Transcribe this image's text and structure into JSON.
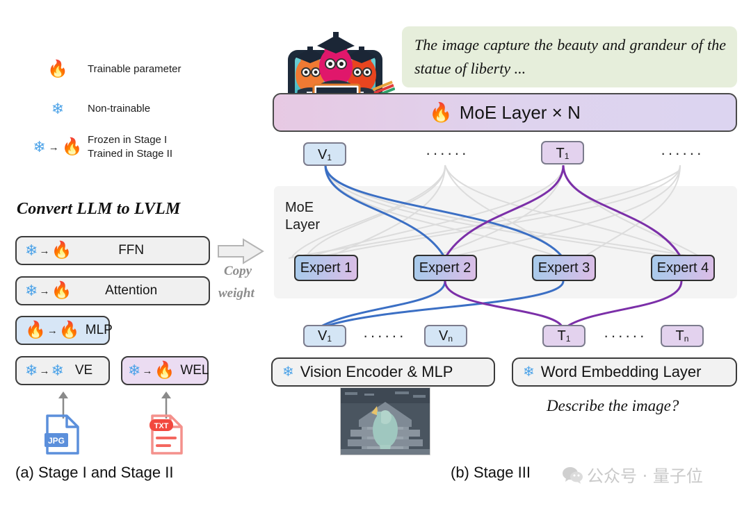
{
  "legend": {
    "items": [
      {
        "icons": "fire",
        "label": "Trainable parameter"
      },
      {
        "icons": "snow",
        "label": "Non-trainable"
      },
      {
        "icons": "snow-to-fire",
        "label_line1": "Frozen in Stage I",
        "label_line2": "Trained in Stage II"
      }
    ]
  },
  "left_panel": {
    "title": "Convert LLM to LVLM",
    "boxes": [
      {
        "label": "FFN",
        "tag": "snow-to-fire",
        "style": "gray"
      },
      {
        "label": "Attention",
        "tag": "snow-to-fire",
        "style": "gray"
      },
      {
        "label": "MLP",
        "tag": "fire-to-fire",
        "style": "blue"
      },
      {
        "label": "VE",
        "tag": "snow-to-snow",
        "style": "gray"
      },
      {
        "label": "WEL",
        "tag": "snow-to-fire",
        "style": "purple"
      }
    ],
    "copy_arrow_caption_line1": "Copy",
    "copy_arrow_caption_line2": "weight",
    "file_icons": [
      {
        "name": "jpg-file-icon",
        "label": "JPG",
        "color": "#5b8fdb"
      },
      {
        "name": "txt-file-icon",
        "label": "TXT",
        "color": "#f4675f"
      }
    ]
  },
  "right_panel": {
    "speech_bubble": "The image capture the beauty and grandeur of the statue of liberty ...",
    "moe_bar_label": "MoE Layer × N",
    "moe_bar_icon": "fire",
    "moe_panel_label_line1": "MoE",
    "moe_panel_label_line2": "Layer",
    "top_tokens": [
      {
        "base": "V",
        "sub": "1",
        "kind": "v"
      },
      {
        "base": "T",
        "sub": "1",
        "kind": "t"
      }
    ],
    "top_dots": [
      "······",
      "······"
    ],
    "experts": [
      "Expert 1",
      "Expert 2",
      "Expert 3",
      "Expert 4"
    ],
    "bottom_tokens": [
      {
        "base": "V",
        "sub": "1",
        "kind": "v"
      },
      {
        "base": "V",
        "sub": "n",
        "kind": "v"
      },
      {
        "base": "T",
        "sub": "1",
        "kind": "t"
      },
      {
        "base": "T",
        "sub": "n",
        "kind": "t"
      }
    ],
    "bottom_dots": [
      "······",
      "······"
    ],
    "encoders": [
      {
        "label": "Vision Encoder & MLP",
        "icon": "snow"
      },
      {
        "label": "Word Embedding Layer",
        "icon": "snow"
      }
    ],
    "prompt": "Describe the image?",
    "image_alt": "statue-of-liberty-aerial-photo",
    "mascot_alt": "three-llamas-with-graduation-caps"
  },
  "captions": {
    "left": "(a) Stage I and Stage II",
    "right": "(b) Stage III",
    "watermark": "公众号 · 量子位"
  },
  "colors": {
    "fire": "#f2713b",
    "snow": "#4da3e8",
    "bubble_bg": "#e6eedb",
    "expert_grad_start": "#a7cbeb",
    "expert_grad_end": "#dcbde6",
    "v_token": "#d4e5f5",
    "t_token": "#e3d2ee",
    "wire_vision": "#3b6fc4",
    "wire_text": "#7b2fa8",
    "wire_idle": "#d8d8d8"
  }
}
